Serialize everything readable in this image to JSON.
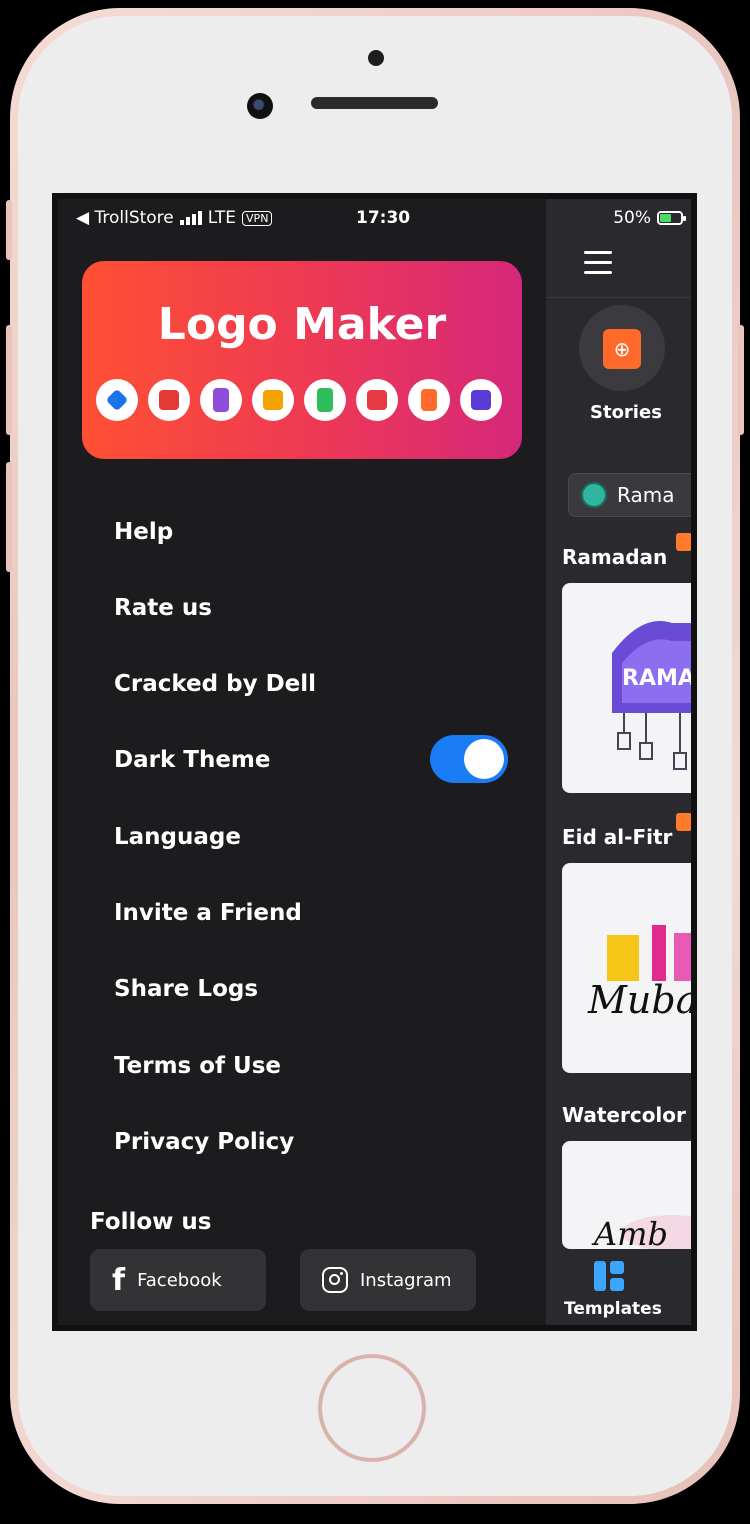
{
  "status_bar": {
    "carrier": "◀ TrollStore",
    "network": "LTE",
    "vpn": "VPN",
    "time": "17:30",
    "battery": "50%"
  },
  "banner": {
    "title": "Logo Maker",
    "icons": [
      "diamond-icon",
      "id-card-icon",
      "badge-icon",
      "certificate-icon",
      "money-icon",
      "image-icon",
      "stories-icon",
      "photo-icon"
    ],
    "icon_colors": [
      "#1a73e8",
      "#e53935",
      "#8e4dd6",
      "#f4a300",
      "#2ebd5a",
      "#e53945",
      "#ff6a2b",
      "#5b3bd6"
    ]
  },
  "menu": {
    "items": [
      {
        "label": "Help"
      },
      {
        "label": "Rate us"
      },
      {
        "label": "Cracked by Dell"
      },
      {
        "label": "Dark Theme"
      },
      {
        "label": "Language"
      },
      {
        "label": "Invite a Friend"
      },
      {
        "label": "Share Logs"
      },
      {
        "label": "Terms of Use"
      },
      {
        "label": "Privacy Policy"
      }
    ],
    "dark_theme_on": true
  },
  "follow": {
    "title": "Follow us",
    "facebook": "Facebook",
    "instagram": "Instagram"
  },
  "right_panel": {
    "stories_label": "Stories",
    "chip_label": "Rama",
    "sections": [
      {
        "title": "Ramadan",
        "card_text": "RAMAD"
      },
      {
        "title": "Eid al-Fitr",
        "card_text": "Mubar"
      },
      {
        "title": "Watercolor",
        "card_text": "Amb"
      }
    ],
    "tab_label": "Templates"
  },
  "colors": {
    "accent": "#1a7cf5",
    "banner_start": "#ff5033",
    "banner_end": "#d6277a"
  }
}
